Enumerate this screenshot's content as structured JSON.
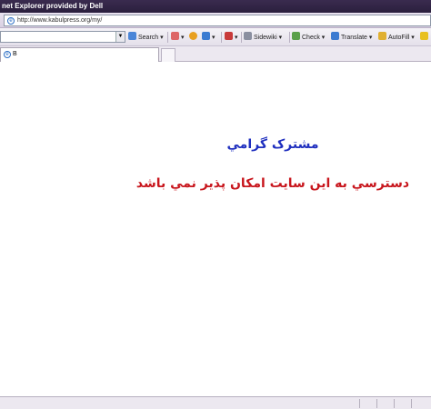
{
  "window": {
    "title": "net Explorer provided by Dell"
  },
  "address_bar": {
    "url": "http://www.kabulpress.org/my/"
  },
  "toolbar": {
    "search_label": "Search",
    "sidewiki_label": "Sidewiki",
    "check_label": "Check",
    "translate_label": "Translate",
    "autofill_label": "AutoFill"
  },
  "tab": {
    "title": "B"
  },
  "page": {
    "title": "مشترک گرامي",
    "message": "دسترسي به اين سايت امکان پذير نمي باشد"
  }
}
